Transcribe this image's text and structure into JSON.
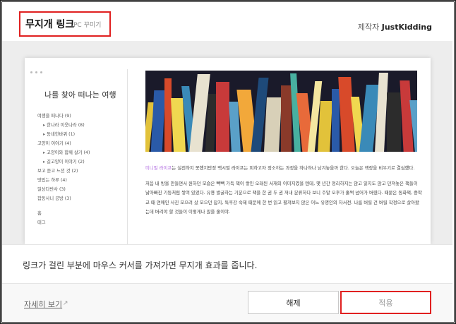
{
  "header": {
    "title": "무지개 링크",
    "subtitle": "PC 꾸미기",
    "author_label": "제작자",
    "author_name": "JustKidding"
  },
  "preview": {
    "blog_title": "나를 찾아 떠나는 여행",
    "menu": [
      {
        "label": "여행을 떠나다 (9)",
        "level": 0
      },
      {
        "label": "한나라 이웃나라 (8)",
        "level": 1
      },
      {
        "label": "동네한바퀴 (1)",
        "level": 1
      },
      {
        "label": "고양이 이야기 (4)",
        "level": 0
      },
      {
        "label": "고양이와 함께 살기 (4)",
        "level": 1
      },
      {
        "label": "길고양이 이야기 (2)",
        "level": 1
      },
      {
        "label": "보고 듣고 느낀 것 (2)",
        "level": 0
      },
      {
        "label": "맛있는 하루 (4)",
        "level": 0
      },
      {
        "label": "일상다반사 (3)",
        "level": 0
      },
      {
        "label": "잡동사니 공방 (3)",
        "level": 0
      },
      {
        "label": "홈",
        "level": 0,
        "gap": true
      },
      {
        "label": "태그",
        "level": 0
      }
    ],
    "post_highlight": "미니멀 라이프",
    "post_p1": "는 실천하지 못했지만정 백시멀 라이프는 피하고자 정소하는 과정을 하나하나 남겨놓을까 한다. 오늘은 책장을 비우기로 결심했다.",
    "post_p2": "처음 내 방을 만들면서 원하던 모습은 빽빽 가득 책이 쌓인 오래된 서재의 이미지였을 텐데, 몇 년간 정리하지는 않고 읽지도 않고 던져놓은 책들이 낡아빠진 기둥처럼 쌓여 있었다. 유용 발굴하는 기분으로 책을 한 권 두 권 꺼내 분류하다 보니 주말 오후가 훌쩍 넘어가 버렸다. 때묻은 동화책, 중학교 때 연애인 사진 모으려 샀 모으던 잡지, 특후강 숙제 때문에 한 번 읽고 펼쳐보지 않은 어느 유명인의 자서전. 나름 버릴 건 버릴 작정으로 살아왔는데 버려야 할 것들이 이렇게나 많을 줄이야."
  },
  "message": "링크가 걸린 부분에 마우스 커서를 가져가면 무지개 효과를 줍니다.",
  "footer": {
    "more_label": "자세히 보기",
    "release_label": "해제",
    "apply_label": "적용"
  },
  "colors": {
    "highlight_border": "#e02020",
    "link_rainbow": "#b06ae0"
  }
}
